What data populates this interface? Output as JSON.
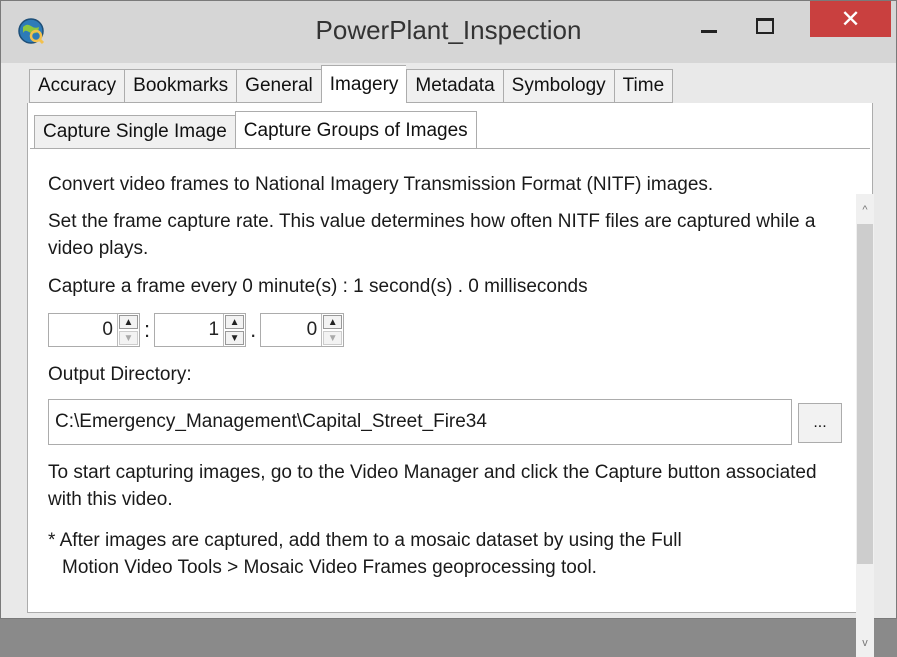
{
  "window": {
    "title": "PowerPlant_Inspection",
    "app_icon": "arcgis-globe-icon",
    "minimize_icon": "minimize-icon",
    "maximize_icon": "maximize-icon",
    "close_icon": "close-icon",
    "close_glyph": "✕",
    "accent_close": "#c9403f"
  },
  "tabs": [
    {
      "label": "Accuracy"
    },
    {
      "label": "Bookmarks"
    },
    {
      "label": "General"
    },
    {
      "label": "Imagery"
    },
    {
      "label": "Metadata"
    },
    {
      "label": "Symbology"
    },
    {
      "label": "Time"
    }
  ],
  "active_tab": "Imagery",
  "subtabs": [
    {
      "label": "Capture Single Image"
    },
    {
      "label": "Capture Groups of Images"
    }
  ],
  "active_subtab": "Capture Groups of Images",
  "content": {
    "intro": "Convert video frames to National Imagery Transmission Format (NITF) images.",
    "rate_desc": "Set the frame capture rate. This value determines how often NITF files are captured while a video plays.",
    "capture_summary": "Capture a frame every  0 minute(s) : 1 second(s) . 0 milliseconds",
    "spinners": {
      "minutes": "0",
      "seconds": "1",
      "milliseconds": "0",
      "sep1": ":",
      "sep2": ".",
      "up_glyph": "▲",
      "down_glyph": "▼"
    },
    "output_label": "Output Directory:",
    "output_value": "C:\\Emergency_Management\\Capital_Street_Fire34",
    "browse_label": "...",
    "instruction": "To start capturing images, go to the Video Manager and click the Capture button associated with this video.",
    "note_line1": "* After images are captured, add them to a mosaic dataset by using the Full",
    "note_line2": "Motion Video Tools > Mosaic Video Frames geoprocessing tool."
  },
  "scrollbar": {
    "up_glyph": "^",
    "down_glyph": "v"
  }
}
